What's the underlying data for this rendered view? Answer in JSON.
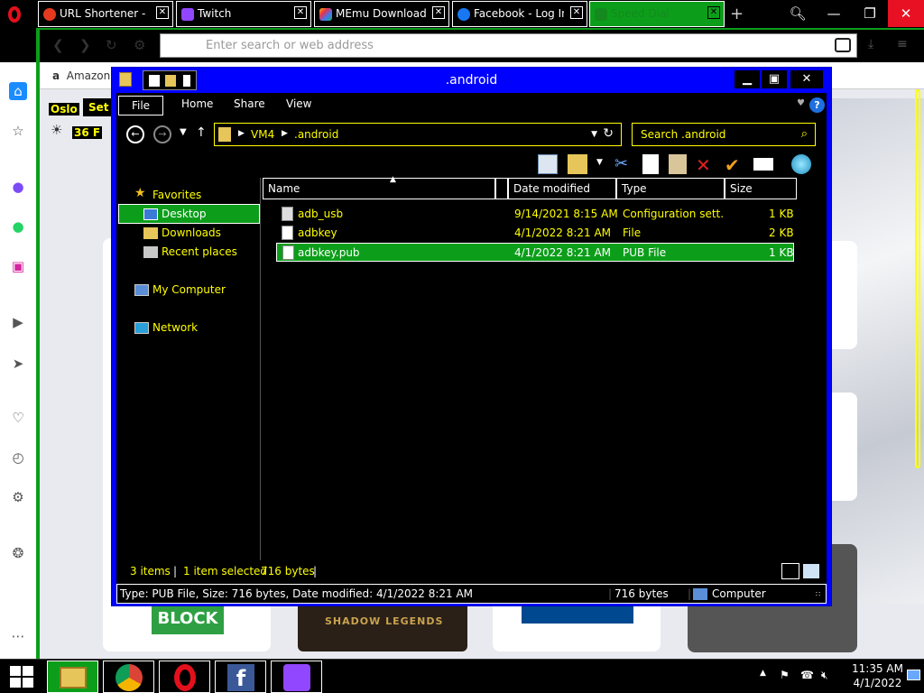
{
  "browser": {
    "tabs": [
      {
        "title": "URL Shortener - Sh",
        "active": false
      },
      {
        "title": "Twitch",
        "active": false
      },
      {
        "title": "MEmu Download",
        "active": false
      },
      {
        "title": "Facebook - Log In",
        "active": false
      },
      {
        "title": "Speed Dial",
        "active": true
      }
    ],
    "close_glyph": "✕",
    "new_tab": "+",
    "address_placeholder": "Enter search or web address",
    "bookmark": "Amazon",
    "weather": {
      "city": "Oslo",
      "set": "Set",
      "temp": "36 F"
    },
    "tiles": {
      "hr_block": "BLOCK",
      "raid": "SHADOW LEGENDS"
    },
    "colors": {
      "accent": "#0c9e1a",
      "highlight": "#ffff00",
      "window_frame": "#0000ff"
    }
  },
  "explorer": {
    "title": ".android",
    "ribbon_tabs": [
      "File",
      "Home",
      "Share",
      "View"
    ],
    "breadcrumb": [
      "VM4",
      ".android"
    ],
    "search_placeholder": "Search .android",
    "nav": {
      "favorites": "Favorites",
      "desktop": "Desktop",
      "downloads": "Downloads",
      "recent": "Recent places",
      "computer": "My Computer",
      "network": "Network"
    },
    "columns": [
      "Name",
      "Date modified",
      "Type",
      "Size"
    ],
    "files": [
      {
        "name": "adb_usb",
        "date": "9/14/2021 8:15 AM",
        "type": "Configuration sett...",
        "size": "1 KB",
        "selected": false
      },
      {
        "name": "adbkey",
        "date": "4/1/2022 8:21 AM",
        "type": "File",
        "size": "2 KB",
        "selected": false
      },
      {
        "name": "adbkey.pub",
        "date": "4/1/2022 8:21 AM",
        "type": "PUB File",
        "size": "1 KB",
        "selected": true
      }
    ],
    "status": {
      "items": "3 items",
      "selected": "1 item selected",
      "size": "716 bytes"
    },
    "details": {
      "info": "Type: PUB File, Size: 716 bytes, Date modified: 4/1/2022 8:21 AM",
      "size": "716 bytes",
      "location": "Computer"
    }
  },
  "taskbar": {
    "time": "11:35 AM",
    "date": "4/1/2022"
  }
}
